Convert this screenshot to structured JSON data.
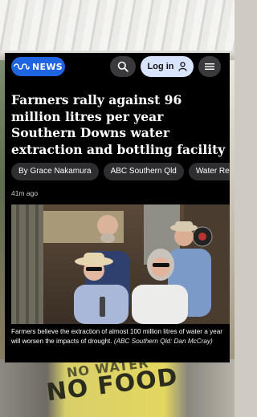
{
  "background": {
    "shirt_line1": "NO WATER",
    "shirt_line2": "NO FOOD"
  },
  "header": {
    "logo_text": "NEWS",
    "login_label": "Log in",
    "icons": {
      "logo": "abc-logo-icon",
      "search": "search-icon",
      "user": "user-icon",
      "menu": "hamburger-menu-icon"
    },
    "colors": {
      "logo_bg": "#1f64e0",
      "login_bg": "#d7e4fb",
      "button_bg": "#3a3a3d"
    }
  },
  "article": {
    "headline": "Farmers rally against 96 million litres per year Southern Downs water extraction and bottling facility",
    "chips": [
      "By Grace Nakamura",
      "ABC Southern Qld",
      "Water Resources"
    ],
    "timestamp": "41m ago",
    "caption_text": "Farmers believe the extraction of almost 100 million litres of water a year will worsen the impacts of drought.",
    "caption_credit": "(ABC Southern Qld: Dan McCray)"
  }
}
